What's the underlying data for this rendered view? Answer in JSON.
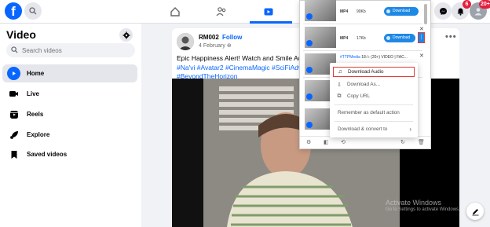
{
  "topbar": {
    "logo": "f",
    "badges": {
      "notifications": "6",
      "account": "20+"
    }
  },
  "sidebar": {
    "title": "Video",
    "search_placeholder": "Search videos",
    "items": [
      {
        "label": "Home",
        "icon": "play-circle-icon",
        "active": true
      },
      {
        "label": "Live",
        "icon": "live-video-icon",
        "active": false
      },
      {
        "label": "Reels",
        "icon": "reels-icon",
        "active": false
      },
      {
        "label": "Explore",
        "icon": "rocket-icon",
        "active": false
      },
      {
        "label": "Saved videos",
        "icon": "bookmark-icon",
        "active": false
      }
    ]
  },
  "post": {
    "author": "RM002",
    "follow_label": "Follow",
    "date": "4 February",
    "text_main": "Epic Happiness Alert! Watch and Smile Awa",
    "tags_line1": "#Na'vi #Avatar2 #CinemaMagic #SciFiAdv",
    "tags_line2": "#BeyondTheHorizon",
    "more_label": "•••"
  },
  "extension": {
    "rows": [
      {
        "title_prefix": "",
        "title": "",
        "format": "MP4",
        "resolution": "90Kb",
        "button": "Download"
      },
      {
        "title_prefix": "",
        "title": "",
        "format": "MP4",
        "resolution": "17Kb",
        "button": "Download"
      },
      {
        "title_prefix": "#TTPMedia",
        "title": "18·⁄♪  (20+) VIDEO | FAC...",
        "format": "",
        "resolution": "",
        "button": ""
      }
    ],
    "row2_more": "⋮",
    "menu": {
      "items": [
        {
          "label": "Download Audio",
          "icon": "♫"
        },
        {
          "label": "Download As...",
          "icon": "⇩"
        },
        {
          "label": "Copy URL",
          "icon": "⧉"
        },
        {
          "label": "Remember as default action",
          "icon": ""
        },
        {
          "label": "Download & convert to",
          "icon": ""
        }
      ],
      "submenu_arrow": "›"
    }
  },
  "watermark": {
    "line1": "Activate Windows",
    "line2": "Go to Settings to activate Windows."
  },
  "colors": {
    "brand": "#0866ff",
    "badge": "#e41e3f",
    "download_button": "#1e88e5",
    "highlight": "#e53935"
  }
}
